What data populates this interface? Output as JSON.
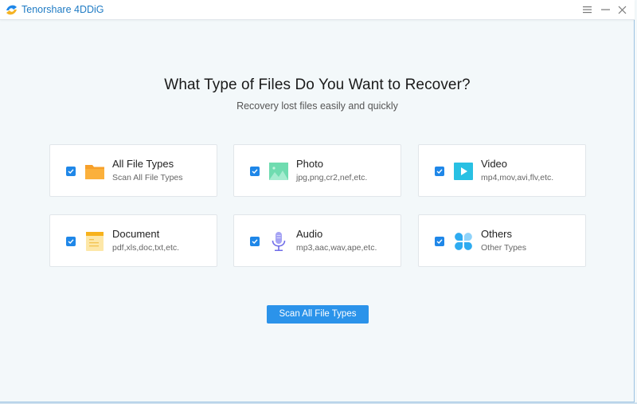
{
  "window": {
    "app_title": "Tenorshare 4DDiG",
    "controls": {
      "menu_icon": "hamburger-menu-icon",
      "minimize_icon": "minimize-icon",
      "close_icon": "close-icon"
    }
  },
  "main": {
    "heading": "What Type of Files Do You Want to Recover?",
    "subheading": "Recovery lost files easily and quickly",
    "file_types": [
      {
        "title": "All File Types",
        "subtitle": "Scan All File Types",
        "icon": "folder-icon",
        "checked": true
      },
      {
        "title": "Photo",
        "subtitle": "jpg,png,cr2,nef,etc.",
        "icon": "photo-icon",
        "checked": true
      },
      {
        "title": "Video",
        "subtitle": "mp4,mov,avi,flv,etc.",
        "icon": "video-play-icon",
        "checked": true
      },
      {
        "title": "Document",
        "subtitle": "pdf,xls,doc,txt,etc.",
        "icon": "document-icon",
        "checked": true
      },
      {
        "title": "Audio",
        "subtitle": "mp3,aac,wav,ape,etc.",
        "icon": "microphone-icon",
        "checked": true
      },
      {
        "title": "Others",
        "subtitle": "Other Types",
        "icon": "others-grid-icon",
        "checked": true
      }
    ],
    "scan_button_label": "Scan All File Types"
  },
  "colors": {
    "accent": "#2b93ea",
    "title_text": "#1f7bc4",
    "checkbox": "#1f87e8",
    "background": "#f3f8fa"
  }
}
